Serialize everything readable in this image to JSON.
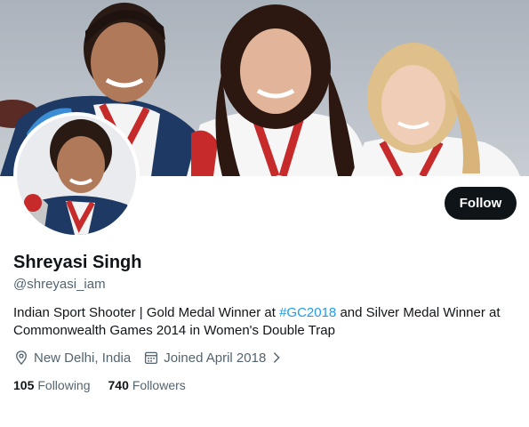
{
  "profile": {
    "banner_image": "three women athletes smiling in white team jackets",
    "avatar_image": "smiling woman with medal ribbon",
    "name": "Shreyasi Singh",
    "handle": "@shreyasi_iam",
    "bio_part1": "Indian Sport Shooter | Gold Medal Winner at ",
    "bio_hashtag": "#GC2018",
    "bio_part2": " and Silver Medal Winner at Commonwealth Games 2014 in Women's Double Trap",
    "location": "New Delhi, India",
    "joined": "Joined April 2018",
    "following_count": "105",
    "following_label": "Following",
    "followers_count": "740",
    "followers_label": "Followers"
  },
  "actions": {
    "follow_label": "Follow"
  },
  "icons": {
    "location": "location-pin-icon",
    "calendar": "calendar-icon",
    "chevron": "chevron-right-icon"
  },
  "colors": {
    "accent": "#1d9bf0",
    "button_bg": "#0f1419",
    "secondary_text": "#536471"
  }
}
